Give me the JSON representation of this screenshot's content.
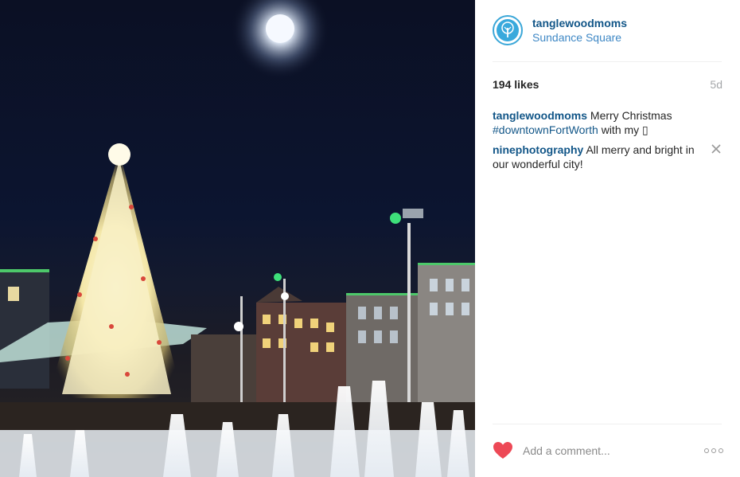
{
  "post": {
    "username": "tanglewoodmoms",
    "location": "Sundance Square",
    "likes": "194 likes",
    "time_ago": "5d"
  },
  "comments": [
    {
      "user": "tanglewoodmoms",
      "text_before": " Merry Christmas ",
      "hashtag": "#downtownFortWorth",
      "text_after": " with my ▯"
    },
    {
      "user": "ninephotography",
      "text": " All merry and bright in our wonderful city!"
    }
  ],
  "footer": {
    "comment_placeholder": "Add a comment..."
  },
  "icons": {
    "avatar": "tree-logo-avatar",
    "like": "heart-icon",
    "delete_comment": "close-icon",
    "more_options": "more-options-icon"
  },
  "colors": {
    "username_link": "#125688",
    "location_link": "#3f88c5",
    "heart": "#ed4956",
    "avatar_ring": "#3ba7d8"
  }
}
